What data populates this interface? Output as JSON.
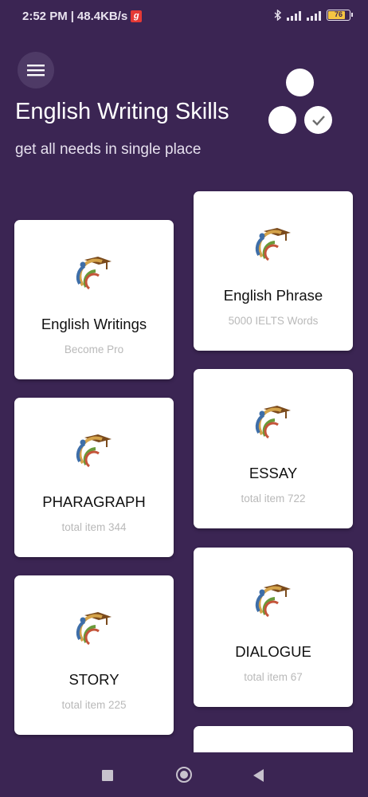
{
  "status": {
    "time": "2:52 PM",
    "speed": "48.4KB/s",
    "app_badge": "g",
    "battery": "76"
  },
  "header": {
    "title": "English Writing Skills",
    "subtitle": "get all needs in single place"
  },
  "cards": [
    {
      "title": "English Writings",
      "subtitle": "Become Pro"
    },
    {
      "title": "English Phrase",
      "subtitle": "5000 IELTS Words"
    },
    {
      "title": "PHARAGRAPH",
      "subtitle": "total item 344"
    },
    {
      "title": "ESSAY",
      "subtitle": "total item 722"
    },
    {
      "title": "STORY",
      "subtitle": "total item 225"
    },
    {
      "title": "DIALOGUE",
      "subtitle": "total item 67"
    }
  ],
  "colors": {
    "background": "#3b2553",
    "card": "#ffffff",
    "accent_brown": "#7a4a1c",
    "accent_gold": "#d4a34a"
  },
  "icons": {
    "menu": "hamburger-menu-icon",
    "check": "check-icon",
    "logo": "graduation-cap-logo"
  }
}
